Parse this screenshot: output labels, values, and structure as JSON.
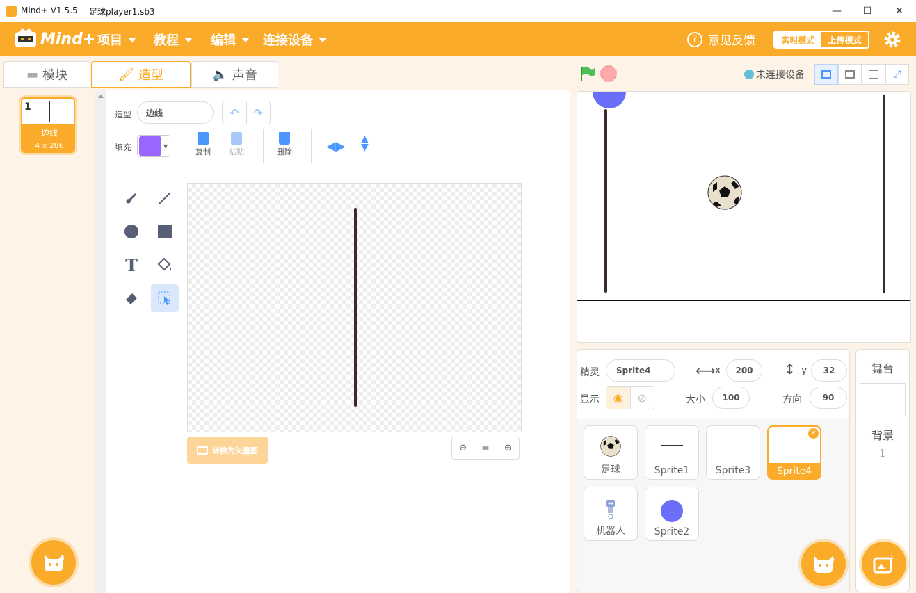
{
  "window": {
    "app_title": "Mind+ V1.5.5",
    "file_title": "足球player1.sb3"
  },
  "menubar": {
    "logo": "Mind+",
    "menus": [
      "项目",
      "教程",
      "编辑",
      "连接设备"
    ],
    "feedback": "意见反馈",
    "mode_realtime": "实时模式",
    "mode_upload": "上传模式"
  },
  "tabs": [
    "模块",
    "造型",
    "声音"
  ],
  "costume": {
    "number": "1",
    "name": "边线",
    "size": "4 x 286"
  },
  "editor": {
    "costume_label": "造型",
    "costume_name": "边线",
    "fill_label": "填充",
    "fill_color": "#9966ff",
    "copy": "复制",
    "paste": "粘贴",
    "delete": "删除",
    "convert_vector": "转换为矢量图",
    "zoom_reset": "="
  },
  "stage_header": {
    "connection": "未连接设备"
  },
  "sprite_info": {
    "sprite_label": "精灵",
    "sprite_name": "Sprite4",
    "x_label": "x",
    "x": "200",
    "y_label": "y",
    "y": "32",
    "show_label": "显示",
    "size_label": "大小",
    "size": "100",
    "direction_label": "方向",
    "direction": "90"
  },
  "sprites": [
    "足球",
    "Sprite1",
    "Sprite3",
    "Sprite4",
    "机器人",
    "Sprite2"
  ],
  "stage_panel": {
    "title": "舞台",
    "backdrop_label": "背景",
    "backdrop_count": "1"
  },
  "colors": {
    "accent": "#fbab2a",
    "purple": "#9966ff",
    "sprite2_blue": "#6a6ef8"
  }
}
